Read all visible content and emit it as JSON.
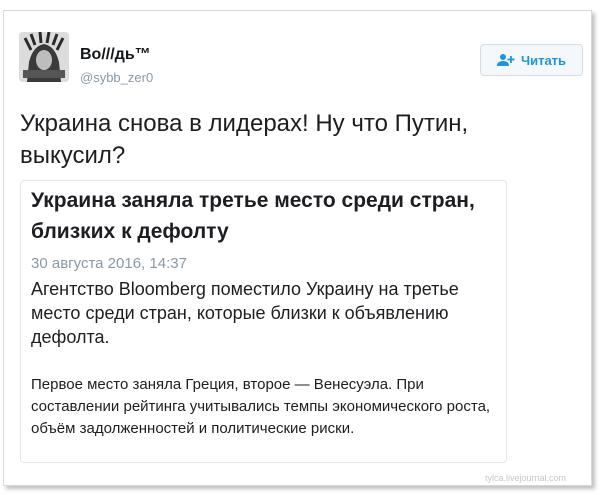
{
  "tweet": {
    "display_name": "Во///дь™",
    "handle": "@sybb_zer0",
    "text": "Украина снова в лидерах! Ну что Путин, выкусил?"
  },
  "follow_button": {
    "label": "Читать",
    "icon": "add-user-icon",
    "color": "#1b95e0"
  },
  "card": {
    "title": "Украина заняла третье место среди стран, близких к дефолту",
    "date": "30 августа 2016, 14:37",
    "lead": "Агентство Bloomberg поместило Украину на третье место среди стран, которые близки к объявлению дефолта.",
    "body": "Первое место заняла Греция, второе — Венесуэла. При составлении рейтинга учитывались темпы экономического роста, объём задолженностей и политические риски."
  },
  "watermark": "tylca.livejournal.com"
}
